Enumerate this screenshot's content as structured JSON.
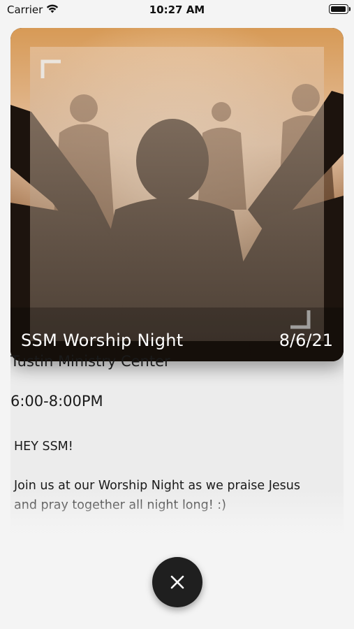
{
  "status_bar": {
    "carrier": "Carrier",
    "time": "10:27 AM",
    "battery_level": 1.0
  },
  "event": {
    "title": "SSM Worship Night",
    "date": "8/6/21",
    "location": "Tustin Ministry Center",
    "time_range": "6:00-8:00PM",
    "greeting": "HEY SSM!",
    "description": "Join us at our Worship Night as we praise Jesus and pray together all night long! :)"
  },
  "icons": {
    "wifi": "wifi-icon",
    "battery": "battery-icon",
    "close": "close-icon"
  },
  "colors": {
    "background": "#f4f4f4",
    "close_button": "#1f1f1f",
    "hero_warm": "#c7894a"
  }
}
